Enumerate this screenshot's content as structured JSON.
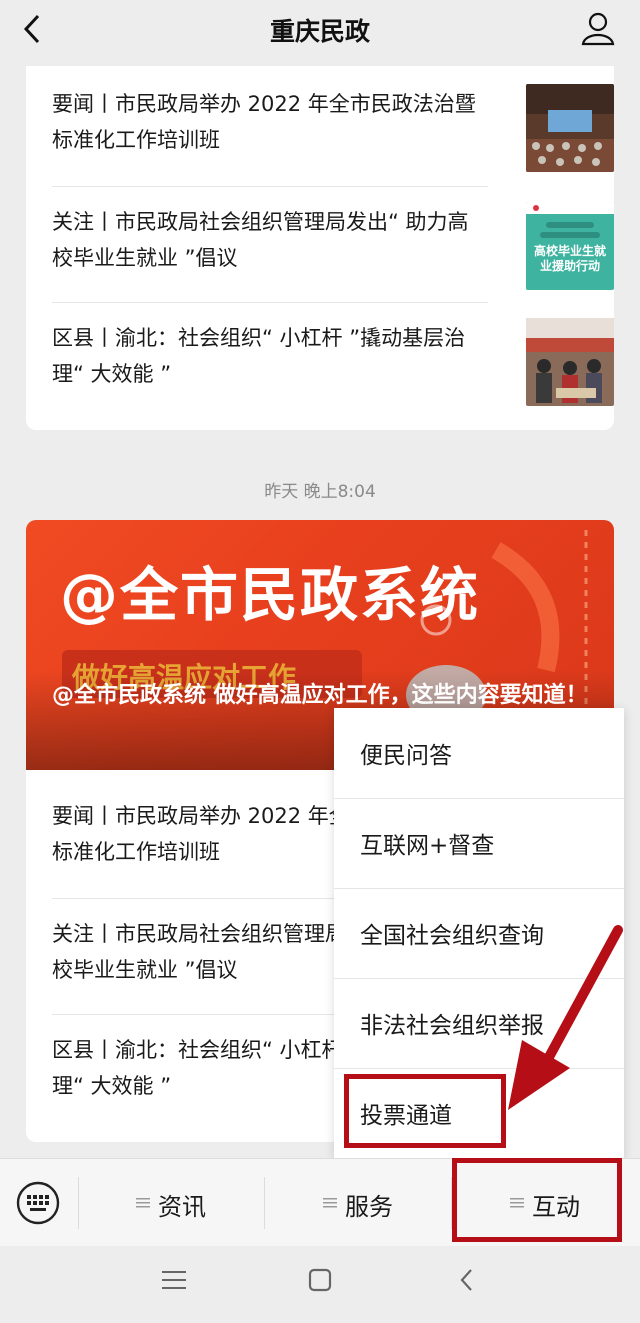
{
  "header": {
    "title": "重庆民政"
  },
  "card1": {
    "items": [
      {
        "text": "要闻丨市民政局举办 2022 年全市民政法治暨标准化工作培训班"
      },
      {
        "text": "关注丨市民政局社会组织管理局发出“ 助力高校毕业生就业 ”倡议",
        "thumb_text": "高校毕业生就业援助行动"
      },
      {
        "text": "区县丨渝北：社会组织“ 小杠杆 ”撬动基层治理“ 大效能 ”"
      }
    ]
  },
  "timestamp": "昨天 晚上8:04",
  "card2": {
    "banner": {
      "big_text": "@全市民政系统",
      "stripe_text": "做好高温应对工作",
      "headline": "@全市民政系统 做好高温应对工作，这些内容要知道！"
    },
    "items": [
      {
        "text": "要闻丨市民政局举办 2022 年全市民政法治暨标准化工作培训班"
      },
      {
        "text": "关注丨市民政局社会组织管理局发出“ 助力高校毕业生就业 ”倡议"
      },
      {
        "text": "区县丨渝北：社会组织“ 小杠杆 ”撬动基层治理“ 大效能 ”"
      }
    ]
  },
  "menu": {
    "items": [
      {
        "label": "便民问答"
      },
      {
        "label": "互联网+督查"
      },
      {
        "label": "全国社会组织查询"
      },
      {
        "label": "非法社会组织举报"
      },
      {
        "label": "投票通道"
      }
    ]
  },
  "bottom_bar": {
    "tabs": [
      {
        "label": "资讯"
      },
      {
        "label": "服务"
      },
      {
        "label": "互动"
      }
    ]
  },
  "colors": {
    "highlight": "#b50e16",
    "banner": "#e8401e",
    "background": "#ededed"
  }
}
